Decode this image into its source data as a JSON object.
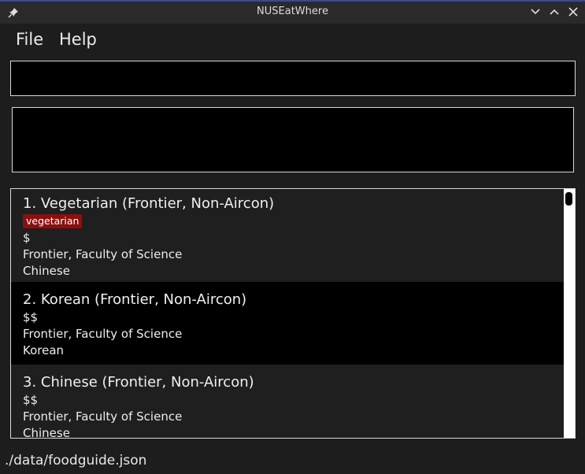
{
  "window": {
    "title": "NUSEatWhere"
  },
  "menu": {
    "file": "File",
    "help": "Help"
  },
  "command_box": {
    "value": ""
  },
  "result_box": {
    "text": ""
  },
  "list": [
    {
      "name": "1.  Vegetarian (Frontier, Non-Aircon)",
      "tags": [
        "vegetarian"
      ],
      "price": "$",
      "location": "Frontier, Faculty of Science",
      "cuisine": "Chinese"
    },
    {
      "name": "2.  Korean (Frontier, Non-Aircon)",
      "tags": [],
      "price": "$$",
      "location": "Frontier, Faculty of Science",
      "cuisine": "Korean"
    },
    {
      "name": "3.  Chinese (Frontier, Non-Aircon)",
      "tags": [],
      "price": "$$",
      "location": "Frontier, Faculty of Science",
      "cuisine": "Chinese"
    }
  ],
  "status": {
    "path": "./data/foodguide.json"
  },
  "colors": {
    "tag": "#8b0f0f",
    "window_bg": "#1d1d1d",
    "titlebar_accent": "#3b4a8a"
  },
  "icons": {
    "pin": "pin-icon",
    "minimize": "chevron-down-icon",
    "maximize": "chevron-up-icon",
    "close": "close-icon"
  }
}
